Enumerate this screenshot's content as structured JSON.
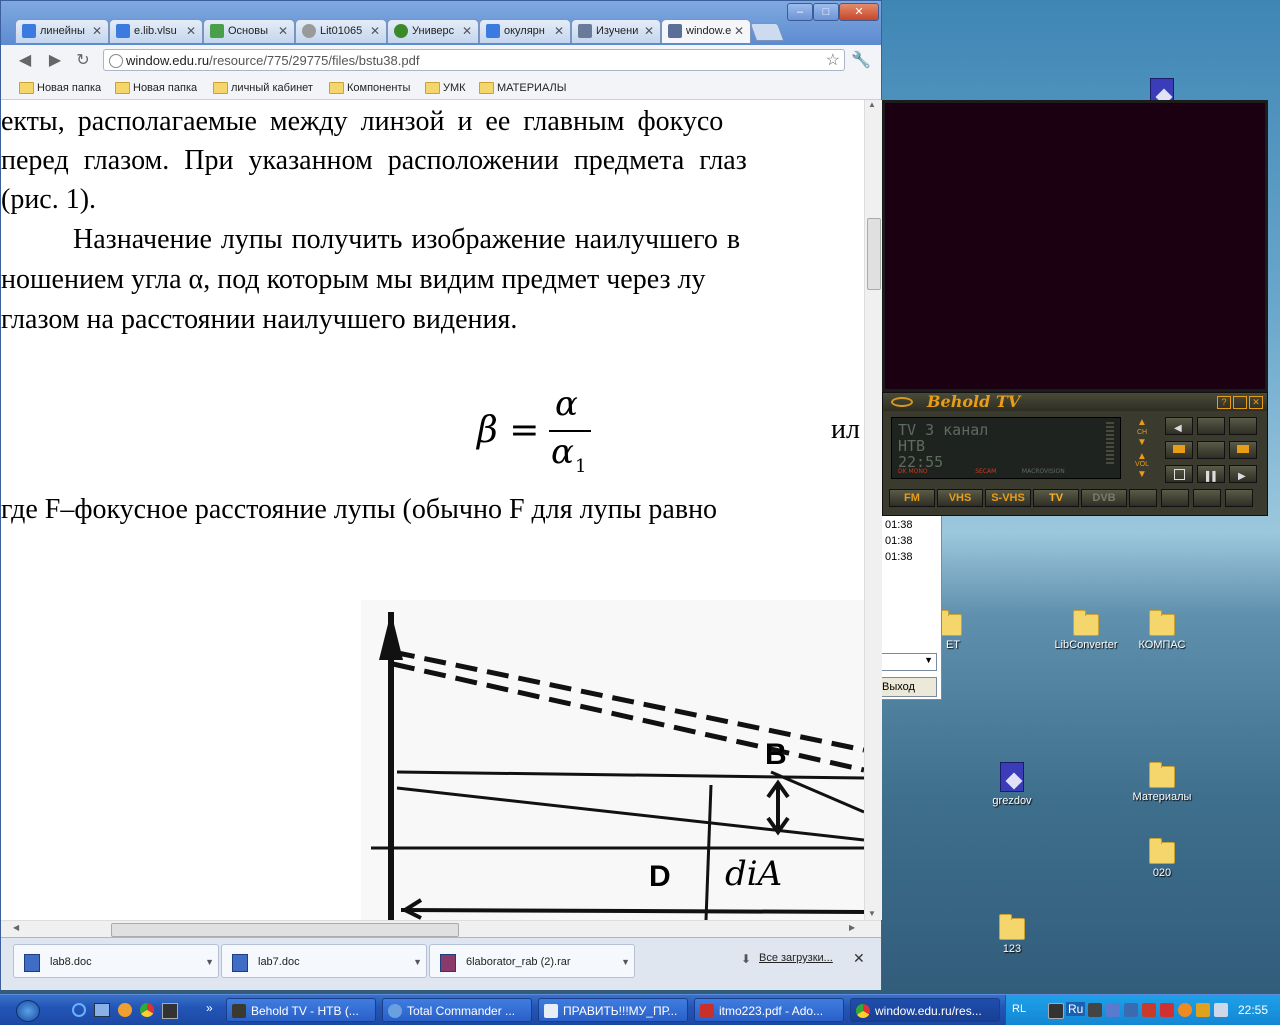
{
  "browser": {
    "tabs": [
      {
        "label": "линейны",
        "favicon_color": "#3b7be0"
      },
      {
        "label": "e.lib.vlsu",
        "favicon_color": "#3b7be0"
      },
      {
        "label": "Основы",
        "favicon_color": "#4aa04a"
      },
      {
        "label": "Lit01065",
        "favicon_color": "#9a9a9a"
      },
      {
        "label": "Универс",
        "favicon_color": "#3a8a2a"
      },
      {
        "label": "окулярн",
        "favicon_color": "#3b7be0"
      },
      {
        "label": "Изучени",
        "favicon_color": "#6a7a9a"
      },
      {
        "label": "window.e",
        "favicon_color": "#5a6e96"
      }
    ],
    "window_controls": {
      "minimize": "–",
      "maximize": "□",
      "close": "✕"
    },
    "url_host": "window.edu.ru",
    "url_path": "/resource/775/29775/files/bstu38.pdf",
    "bookmarks": [
      "Новая папка",
      "Новая папка",
      "личный кабинет",
      "Компоненты",
      "УМК",
      "МАТЕРИАЛЫ"
    ]
  },
  "document": {
    "lines": [
      "екты, располагаемые  между линзой и ее главным фокусо",
      "перед глазом. При указанном расположении предмета глаз",
      "(рис. 1).",
      "Назначение лупы получить изображение наилучшего в",
      "ношением угла α, под которым мы видим предмет через лу",
      "глазом на расстоянии наилучшего   видения.",
      "где  F–фокусное расстояние лупы (обычно F для лупы равно"
    ],
    "formula": {
      "lhs": "β =",
      "numerator": "α",
      "denominator": "α",
      "subscript": "1",
      "trailing": "ил"
    },
    "figure_labels": {
      "b": "B",
      "d": "D",
      "dia": "diA"
    }
  },
  "downloads": {
    "items": [
      "lab8.doc",
      "lab7.doc",
      "6laborator_rab (2).rar"
    ],
    "all_link": "Все загрузки...",
    "close": "✕"
  },
  "tv": {
    "title": "Behold TV",
    "lcd_lines": [
      "TV 3 канал",
      "НТВ",
      "22:55"
    ],
    "lcd_tags": [
      "DK MONO",
      "SECAM",
      "MACROVISION"
    ],
    "mode_buttons": [
      "FM",
      "VHS",
      "S-VHS",
      "TV",
      "DVB"
    ],
    "ch_label": "CH",
    "vol_label": "VOL"
  },
  "behind_window": {
    "times": [
      "01:38",
      "01:38",
      "01:38"
    ],
    "exit_label": "Выход"
  },
  "desktop_icons": [
    {
      "label": "LibConverter"
    },
    {
      "label": "КОМПАС"
    },
    {
      "label": "grezdov"
    },
    {
      "label": "Материалы"
    },
    {
      "label": "020"
    },
    {
      "label": "123"
    },
    {
      "label": "ЕТ"
    }
  ],
  "taskbar": {
    "tasks": [
      {
        "label": "Behold TV - НТВ (..."
      },
      {
        "label": "Total Commander ..."
      },
      {
        "label": "ПРАВИТЬ!!!МУ_ПР..."
      },
      {
        "label": "itmo223.pdf - Ado..."
      },
      {
        "label": "window.edu.ru/res..."
      }
    ],
    "overflow": "»",
    "lang": "Ru",
    "rl": "RL",
    "clock": "22:55"
  }
}
